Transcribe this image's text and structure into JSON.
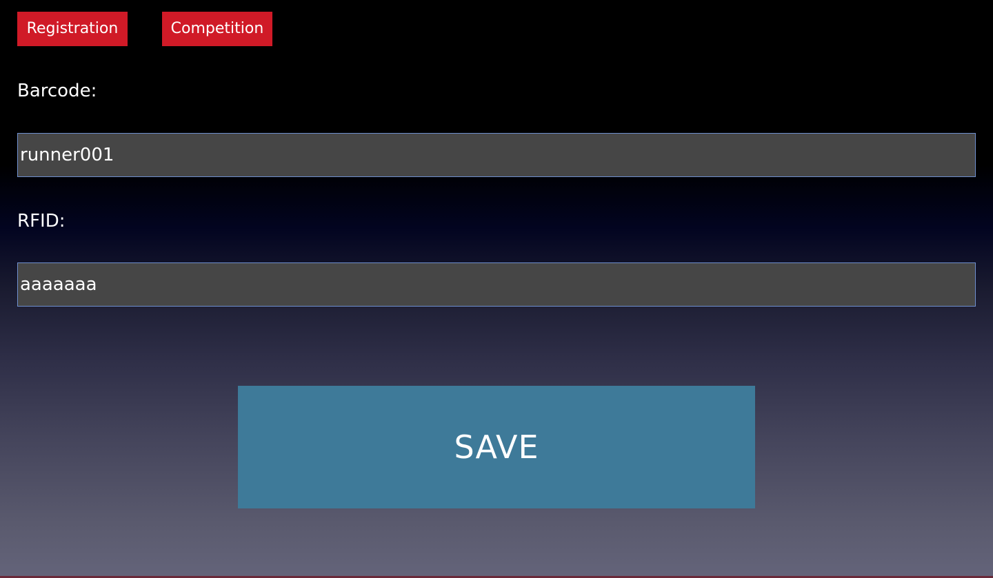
{
  "tabs": {
    "registration_label": "Registration",
    "competition_label": "Competition"
  },
  "form": {
    "barcode_label": "Barcode:",
    "barcode_value": "runner001",
    "rfid_label": "RFID:",
    "rfid_value": "aaaaaaa"
  },
  "save_label": "SAVE",
  "colors": {
    "tab_button": "#d01a27",
    "save_button": "#3e7a99",
    "input_background": "#464646",
    "input_border": "#6f8fcf"
  }
}
